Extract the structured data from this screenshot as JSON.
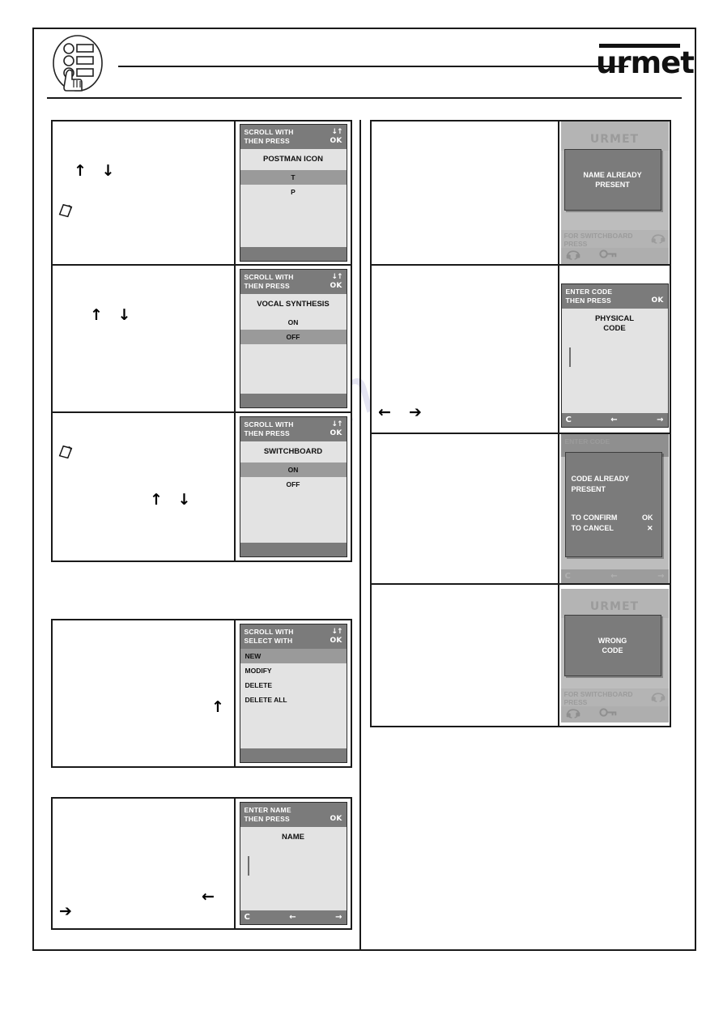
{
  "header": {
    "brand": "urmet",
    "badge_icon": "finger-press-list-icon"
  },
  "watermark": "manualshive.com",
  "left_column": {
    "rows": [
      {
        "id": "postman-icon-row",
        "markers": [
          {
            "name": "up-down-arrows",
            "glyph": "↑ ↓"
          },
          {
            "name": "note-icon",
            "glyph": "note"
          }
        ],
        "screen": {
          "type": "menu",
          "header_line1": "SCROLL WITH",
          "header_line2": "THEN PRESS",
          "hint_top": "↓↑",
          "hint_bottom": "OK",
          "title": "POSTMAN ICON",
          "items": [
            {
              "label": "T",
              "selected": true
            },
            {
              "label": "P",
              "selected": false
            }
          ]
        }
      },
      {
        "id": "vocal-synthesis-row",
        "markers": [
          {
            "name": "up-down-arrows",
            "glyph": "↑ ↓"
          }
        ],
        "screen": {
          "type": "menu",
          "header_line1": "SCROLL WITH",
          "header_line2": "THEN PRESS",
          "hint_top": "↓↑",
          "hint_bottom": "OK",
          "title": "VOCAL SYNTHESIS",
          "items": [
            {
              "label": "ON",
              "selected": false
            },
            {
              "label": "OFF",
              "selected": true
            }
          ]
        }
      },
      {
        "id": "switchboard-row",
        "markers": [
          {
            "name": "note-icon",
            "glyph": "note"
          },
          {
            "name": "up-down-arrows",
            "glyph": "↑ ↓"
          }
        ],
        "screen": {
          "type": "menu",
          "header_line1": "SCROLL WITH",
          "header_line2": "THEN PRESS",
          "hint_top": "↓↑",
          "hint_bottom": "OK",
          "title": "SWITCHBOARD",
          "items": [
            {
              "label": "ON",
              "selected": true
            },
            {
              "label": "OFF",
              "selected": false
            }
          ]
        }
      },
      {
        "id": "new-modify-delete-row",
        "markers": [
          {
            "name": "up-down-arrows",
            "glyph": "↑ ↓"
          }
        ],
        "screen": {
          "type": "list",
          "header_line1": "SCROLL WITH",
          "header_line2": "SELECT WITH",
          "hint_top": "↓↑",
          "hint_bottom": "OK",
          "items": [
            {
              "label": "NEW",
              "selected": true
            },
            {
              "label": "MODIFY",
              "selected": false
            },
            {
              "label": "DELETE",
              "selected": false
            },
            {
              "label": "DELETE ALL",
              "selected": false
            }
          ]
        }
      },
      {
        "id": "enter-name-row",
        "markers": [
          {
            "name": "right-arrow",
            "glyph": "➔"
          },
          {
            "name": "left-arrow",
            "glyph": "←"
          }
        ],
        "screen": {
          "type": "input",
          "header_line1": "ENTER NAME",
          "header_line2": "THEN PRESS",
          "hint_bottom": "OK",
          "title": "NAME",
          "footer_keys": [
            "C",
            "←",
            "→"
          ]
        }
      }
    ]
  },
  "right_column": {
    "rows": [
      {
        "id": "name-already-present-row",
        "markers": [],
        "screen": {
          "type": "dialog-over-home",
          "home_brand": "URMET",
          "home_note_line1": "FOR SWITCHBOARD",
          "home_note_line2": "PRESS",
          "home_note_icon": "intercom-handset-icon",
          "home_bar_icons": [
            "intercom-handset-icon",
            "key-icon"
          ],
          "modal_line1": "NAME ALREADY",
          "modal_line2": "PRESENT"
        }
      },
      {
        "id": "physical-code-row",
        "markers": [
          {
            "name": "left-arrow",
            "glyph": "←"
          },
          {
            "name": "right-arrow",
            "glyph": "➔"
          }
        ],
        "screen": {
          "type": "input",
          "header_line1": "ENTER CODE",
          "header_line2": "THEN PRESS",
          "hint_bottom": "OK",
          "title_line1": "PHYSICAL",
          "title_line2": "CODE",
          "footer_keys": [
            "C",
            "←",
            "→"
          ]
        }
      },
      {
        "id": "code-already-present-row",
        "markers": [],
        "screen": {
          "type": "confirm-over-input",
          "ghost_header": "ENTER CODE",
          "footer_keys": [
            "C",
            "←",
            "→"
          ],
          "modal_line1": "CODE ALREADY",
          "modal_line2": "PRESENT",
          "confirm_label": "TO CONFIRM",
          "confirm_key": "OK",
          "cancel_label": "TO CANCEL",
          "cancel_key": "✕"
        }
      },
      {
        "id": "wrong-code-row",
        "markers": [],
        "screen": {
          "type": "dialog-over-home",
          "home_brand": "URMET",
          "home_note_line1": "FOR SWITCHBOARD",
          "home_note_line2": "PRESS",
          "home_note_icon": "intercom-handset-icon",
          "home_bar_icons": [
            "intercom-handset-icon",
            "key-icon"
          ],
          "modal_line1": "WRONG",
          "modal_line2": "CODE"
        }
      }
    ]
  },
  "colors": {
    "screen_header": "#7b7b7b",
    "screen_body": "#e3e3e3",
    "screen_selected": "#9a9a9a",
    "dim_overlay": "#b4b4b4",
    "ink": "#111111"
  }
}
